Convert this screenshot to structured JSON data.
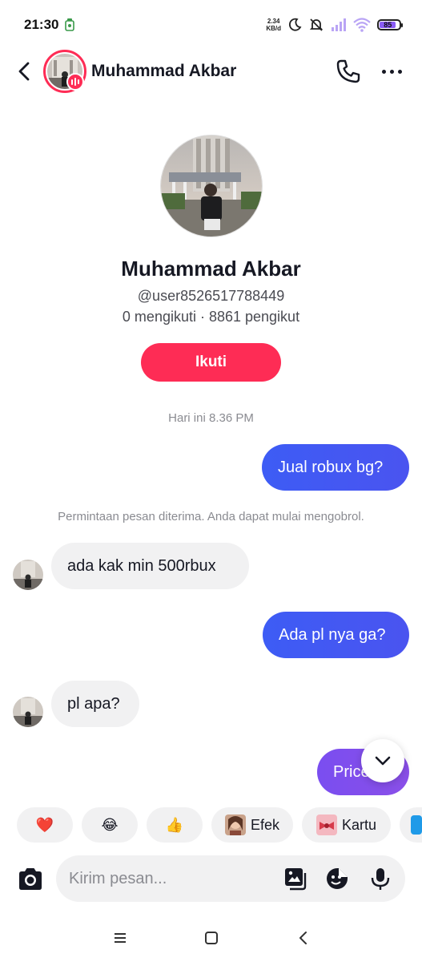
{
  "status_bar": {
    "time": "21:30",
    "net_speed_value": "2.34",
    "net_speed_unit": "KB/d",
    "battery_level": "85"
  },
  "header": {
    "contact_name": "Muhammad Akbar",
    "icons": [
      "back-arrow-icon",
      "phone-icon",
      "more-options-icon"
    ]
  },
  "profile": {
    "name": "Muhammad Akbar",
    "handle": "@user8526517788449",
    "stats": "0 mengikuti · 8861 pengikut",
    "follow_label": "Ikuti"
  },
  "chat": {
    "timestamp": "Hari ini 8.36 PM",
    "system_notice": "Permintaan pesan diterima. Anda dapat mulai mengobrol.",
    "messages": [
      {
        "direction": "out",
        "text": "Jual robux bg?"
      },
      {
        "direction": "in",
        "text": "ada kak min 500rbux"
      },
      {
        "direction": "out",
        "text": "Ada pl nya ga?"
      },
      {
        "direction": "in",
        "text": "pl apa?"
      },
      {
        "direction": "out",
        "text": "Price"
      }
    ]
  },
  "quick_reactions": {
    "emojis": [
      "❤️",
      "😂",
      "👍"
    ],
    "effect_label": "Efek",
    "card_label": "Kartu"
  },
  "composer": {
    "placeholder": "Kirim pesan...",
    "icons": [
      "camera-icon",
      "gallery-icon",
      "sticker-icon",
      "microphone-icon"
    ]
  },
  "colors": {
    "accent": "#fe2c55",
    "outgoing_bubble": "#3d5cf5",
    "incoming_bubble": "#f1f1f2",
    "battery": "#8a5cf5"
  }
}
